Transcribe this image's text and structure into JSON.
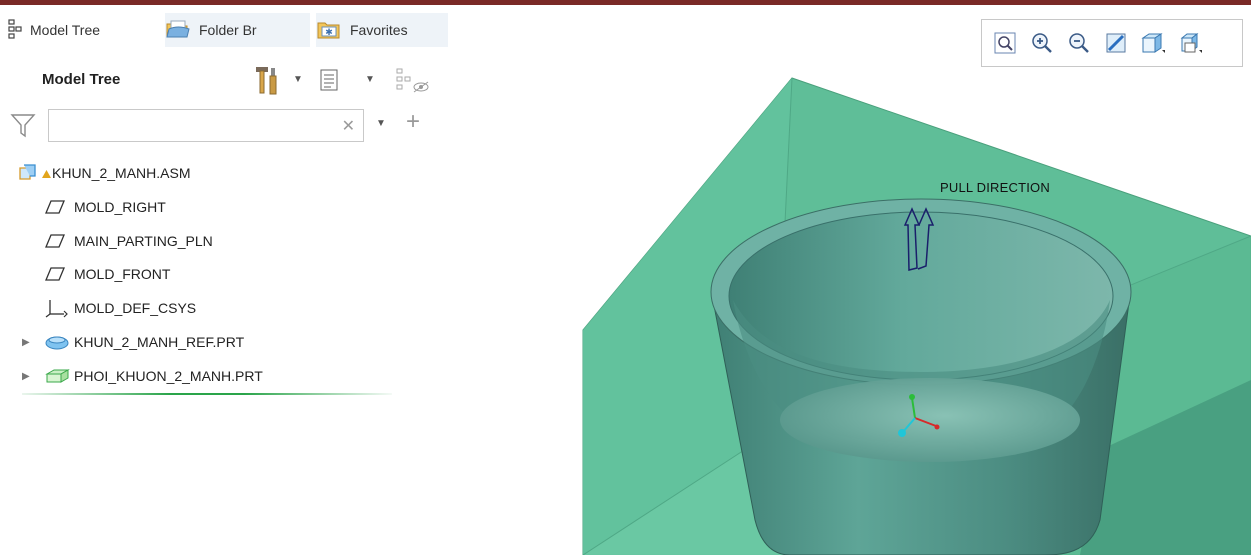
{
  "tabs": [
    {
      "label": "Model Tree",
      "icon": "model-tree-icon"
    },
    {
      "label": "Folder Br",
      "icon": "folder-browser-icon"
    },
    {
      "label": "Favorites",
      "icon": "favorites-icon"
    }
  ],
  "header": {
    "title": "Model Tree",
    "settings_icon": "tools-icon",
    "show_icon": "tree-columns-icon",
    "filter_icon": "tree-filter-icon"
  },
  "search": {
    "value": "",
    "placeholder": "",
    "clear_icon": "clear-icon",
    "add_icon": "plus-icon"
  },
  "tree": {
    "root": {
      "label": "KHUN_2_MANH.ASM",
      "icon": "assembly-icon",
      "badge": "warning-triangle"
    },
    "items": [
      {
        "label": "MOLD_RIGHT",
        "icon": "datum-plane-icon"
      },
      {
        "label": "MAIN_PARTING_PLN",
        "icon": "datum-plane-icon"
      },
      {
        "label": "MOLD_FRONT",
        "icon": "datum-plane-icon"
      },
      {
        "label": "MOLD_DEF_CSYS",
        "icon": "csys-icon"
      },
      {
        "label": "KHUN_2_MANH_REF.PRT",
        "icon": "reference-part-icon",
        "expandable": true
      },
      {
        "label": "PHOI_KHUON_2_MANH.PRT",
        "icon": "workpiece-part-icon",
        "expandable": true
      }
    ]
  },
  "view_toolbar": [
    "refit-icon",
    "zoom-in-icon",
    "zoom-out-icon",
    "repaint-icon",
    "display-style-icon",
    "saved-views-icon"
  ],
  "viewport": {
    "annotation": "PULL DIRECTION"
  },
  "colors": {
    "accent_bar": "#7a2a27",
    "workpiece": "#5fbf98",
    "part": "#4f8f84",
    "tree_highlight": "#2aa44a"
  }
}
